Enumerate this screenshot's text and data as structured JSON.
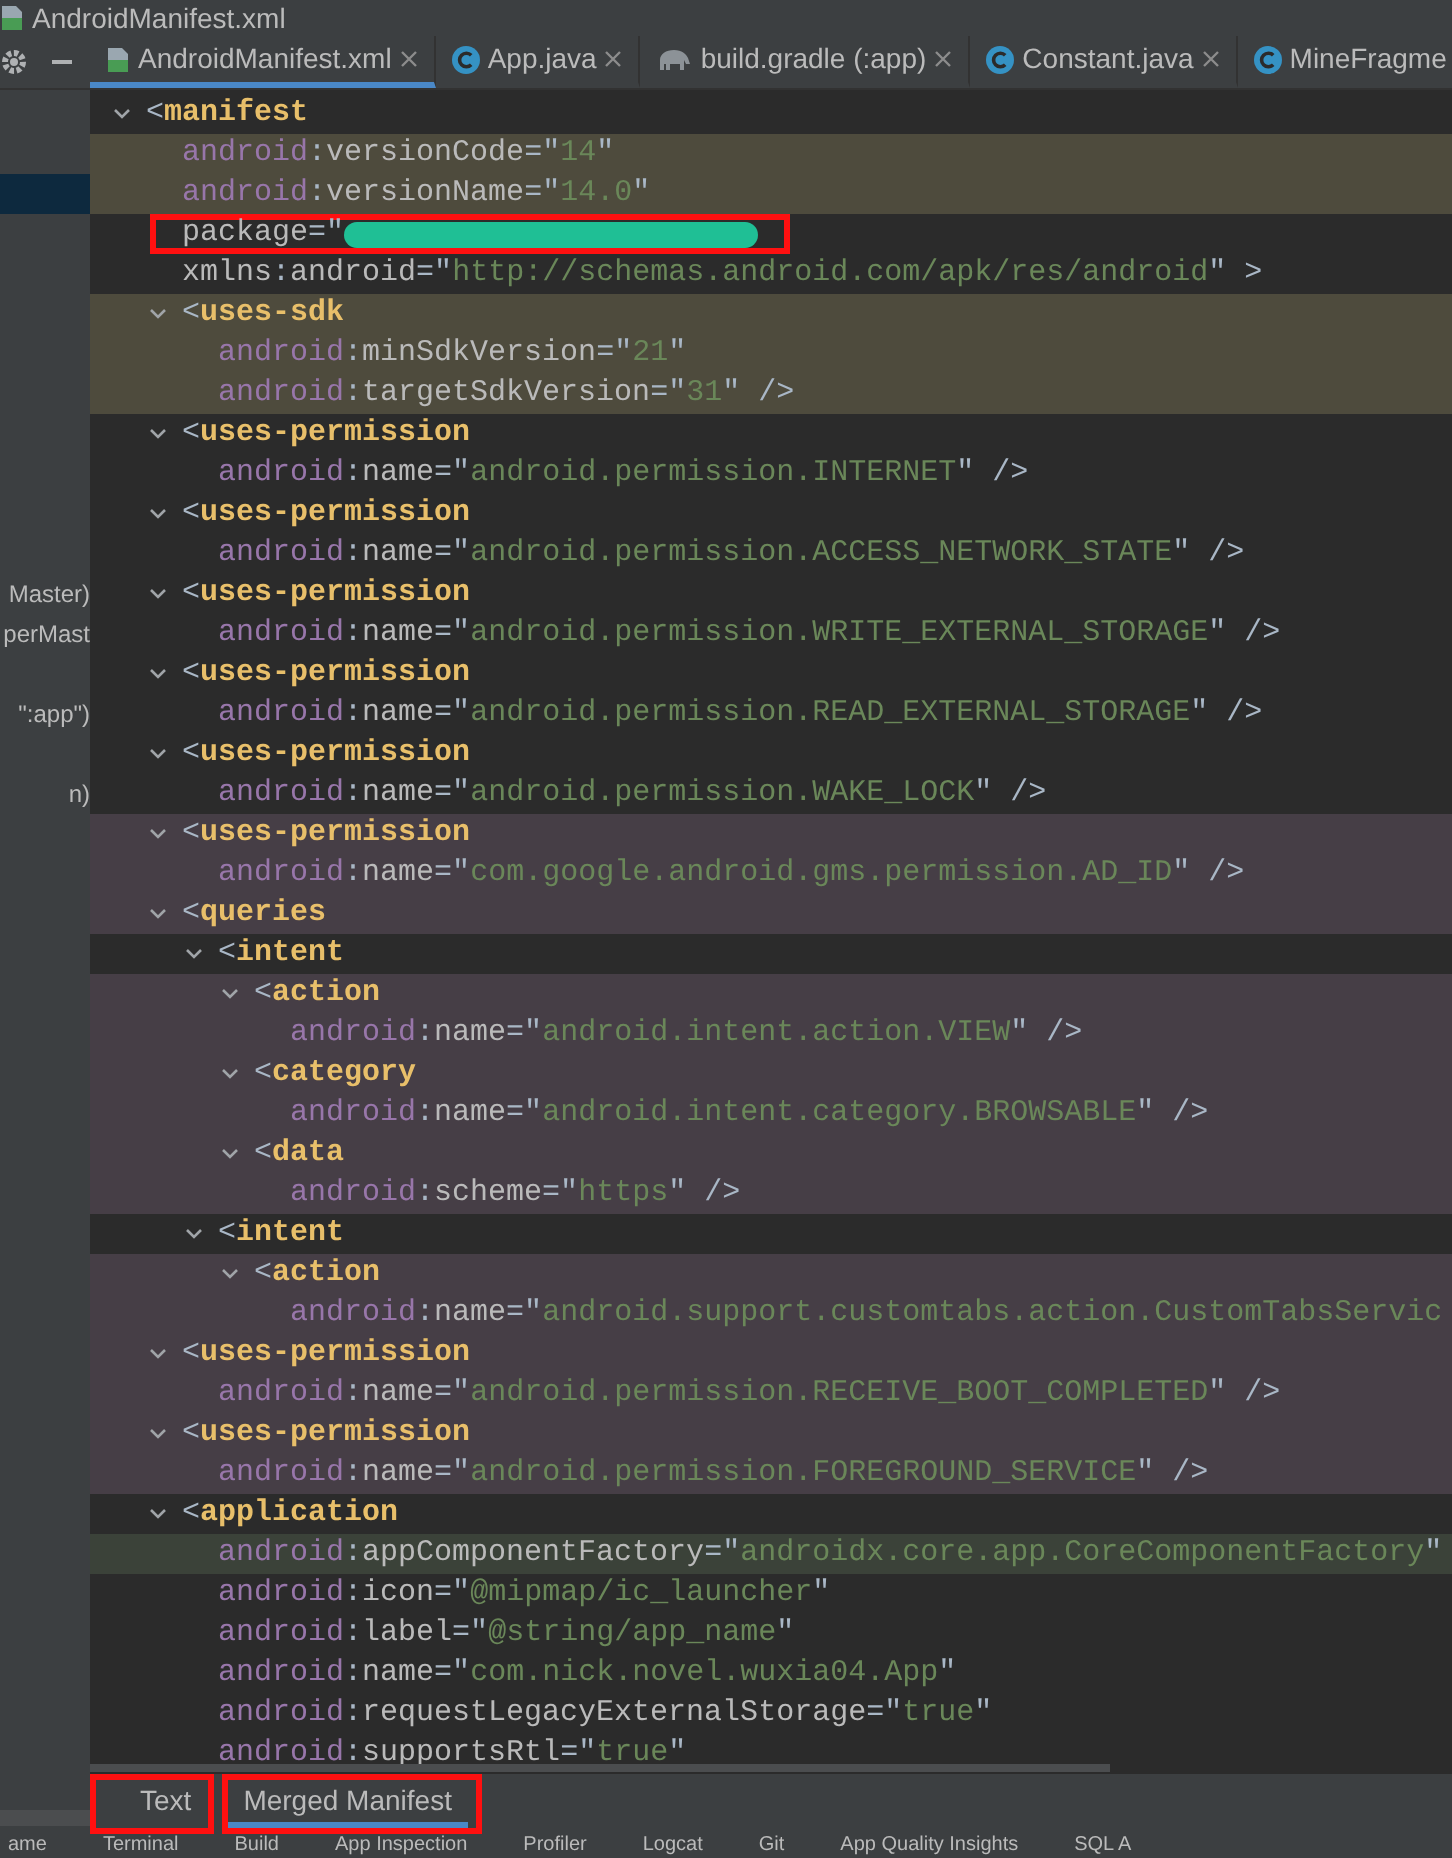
{
  "window": {
    "title": "AndroidManifest.xml"
  },
  "editor_tabs": [
    {
      "label": "AndroidManifest.xml",
      "kind": "manifest",
      "selected": true
    },
    {
      "label": "App.java",
      "kind": "class",
      "selected": false
    },
    {
      "label": "build.gradle (:app)",
      "kind": "gradle",
      "selected": false
    },
    {
      "label": "Constant.java",
      "kind": "class",
      "selected": false
    },
    {
      "label": "MineFragme",
      "kind": "class",
      "selected": false
    }
  ],
  "sidebar": {
    "rows": [
      {
        "selected": true
      },
      {
        "selected": false,
        "text": "Master)"
      },
      {
        "selected": false,
        "text": "perMast"
      },
      {
        "selected": false,
        "text": "\":app\")"
      },
      {
        "selected": false,
        "text": "n)"
      }
    ]
  },
  "manifest": {
    "expanded": true,
    "segments": [
      {
        "kind": "punct",
        "text": "<"
      },
      {
        "kind": "tag",
        "text": "manifest"
      }
    ],
    "children": [
      {
        "color": "#4e4b3d",
        "segments": [
          {
            "kind": "ns",
            "text": "android"
          },
          {
            "kind": "punct",
            "text": ":"
          },
          {
            "kind": "attr",
            "text": "versionCode"
          },
          {
            "kind": "punct",
            "text": "=\""
          },
          {
            "kind": "value",
            "text": "14"
          },
          {
            "kind": "punct",
            "text": "\""
          }
        ]
      },
      {
        "color": "#4e4b3d",
        "segments": [
          {
            "kind": "ns",
            "text": "android"
          },
          {
            "kind": "punct",
            "text": ":"
          },
          {
            "kind": "attr",
            "text": "versionName"
          },
          {
            "kind": "punct",
            "text": "=\""
          },
          {
            "kind": "value",
            "text": "14.0"
          },
          {
            "kind": "punct",
            "text": "\""
          }
        ]
      },
      {
        "outlined": true,
        "segments": [
          {
            "kind": "attr",
            "text": "package"
          },
          {
            "kind": "punct",
            "text": "=\""
          },
          {
            "kind": "redacted"
          }
        ]
      },
      {
        "segments": [
          {
            "kind": "attr",
            "text": "xmlns"
          },
          {
            "kind": "punct",
            "text": ":"
          },
          {
            "kind": "attr",
            "text": "android"
          },
          {
            "kind": "punct",
            "text": "=\""
          },
          {
            "kind": "value",
            "text": "http://schemas.android.com/apk/res/android"
          },
          {
            "kind": "punct",
            "text": "\" >"
          }
        ]
      },
      {
        "color": "#4e4b3d",
        "expanded": true,
        "segments": [
          {
            "kind": "punct",
            "text": "<"
          },
          {
            "kind": "tag",
            "text": "uses-sdk"
          }
        ],
        "children": [
          {
            "color": "#4e4b3d",
            "segments": [
              {
                "kind": "ns",
                "text": "android"
              },
              {
                "kind": "punct",
                "text": ":"
              },
              {
                "kind": "attr",
                "text": "minSdkVersion"
              },
              {
                "kind": "punct",
                "text": "=\""
              },
              {
                "kind": "value",
                "text": "21"
              },
              {
                "kind": "punct",
                "text": "\""
              }
            ]
          },
          {
            "color": "#4e4b3d",
            "segments": [
              {
                "kind": "ns",
                "text": "android"
              },
              {
                "kind": "punct",
                "text": ":"
              },
              {
                "kind": "attr",
                "text": "targetSdkVersion"
              },
              {
                "kind": "punct",
                "text": "=\""
              },
              {
                "kind": "value",
                "text": "31"
              },
              {
                "kind": "punct",
                "text": "\" />"
              }
            ]
          }
        ]
      },
      {
        "expanded": true,
        "segments": [
          {
            "kind": "punct",
            "text": "<"
          },
          {
            "kind": "tag",
            "text": "uses-permission"
          }
        ],
        "children": [
          {
            "segments": [
              {
                "kind": "ns",
                "text": "android"
              },
              {
                "kind": "punct",
                "text": ":"
              },
              {
                "kind": "attr",
                "text": "name"
              },
              {
                "kind": "punct",
                "text": "=\""
              },
              {
                "kind": "value",
                "text": "android.permission.INTERNET"
              },
              {
                "kind": "punct",
                "text": "\" />"
              }
            ]
          }
        ]
      },
      {
        "expanded": true,
        "segments": [
          {
            "kind": "punct",
            "text": "<"
          },
          {
            "kind": "tag",
            "text": "uses-permission"
          }
        ],
        "children": [
          {
            "segments": [
              {
                "kind": "ns",
                "text": "android"
              },
              {
                "kind": "punct",
                "text": ":"
              },
              {
                "kind": "attr",
                "text": "name"
              },
              {
                "kind": "punct",
                "text": "=\""
              },
              {
                "kind": "value",
                "text": "android.permission.ACCESS_NETWORK_STATE"
              },
              {
                "kind": "punct",
                "text": "\" />"
              }
            ]
          }
        ]
      },
      {
        "expanded": true,
        "segments": [
          {
            "kind": "punct",
            "text": "<"
          },
          {
            "kind": "tag",
            "text": "uses-permission"
          }
        ],
        "children": [
          {
            "segments": [
              {
                "kind": "ns",
                "text": "android"
              },
              {
                "kind": "punct",
                "text": ":"
              },
              {
                "kind": "attr",
                "text": "name"
              },
              {
                "kind": "punct",
                "text": "=\""
              },
              {
                "kind": "value",
                "text": "android.permission.WRITE_EXTERNAL_STORAGE"
              },
              {
                "kind": "punct",
                "text": "\" />"
              }
            ]
          }
        ]
      },
      {
        "expanded": true,
        "segments": [
          {
            "kind": "punct",
            "text": "<"
          },
          {
            "kind": "tag",
            "text": "uses-permission"
          }
        ],
        "children": [
          {
            "segments": [
              {
                "kind": "ns",
                "text": "android"
              },
              {
                "kind": "punct",
                "text": ":"
              },
              {
                "kind": "attr",
                "text": "name"
              },
              {
                "kind": "punct",
                "text": "=\""
              },
              {
                "kind": "value",
                "text": "android.permission.READ_EXTERNAL_STORAGE"
              },
              {
                "kind": "punct",
                "text": "\" />"
              }
            ]
          }
        ]
      },
      {
        "expanded": true,
        "segments": [
          {
            "kind": "punct",
            "text": "<"
          },
          {
            "kind": "tag",
            "text": "uses-permission"
          }
        ],
        "children": [
          {
            "segments": [
              {
                "kind": "ns",
                "text": "android"
              },
              {
                "kind": "punct",
                "text": ":"
              },
              {
                "kind": "attr",
                "text": "name"
              },
              {
                "kind": "punct",
                "text": "=\""
              },
              {
                "kind": "value",
                "text": "android.permission.WAKE_LOCK"
              },
              {
                "kind": "punct",
                "text": "\" />"
              }
            ]
          }
        ]
      },
      {
        "color": "#463e46",
        "expanded": true,
        "segments": [
          {
            "kind": "punct",
            "text": "<"
          },
          {
            "kind": "tag",
            "text": "uses-permission"
          }
        ],
        "children": [
          {
            "color": "#463e46",
            "segments": [
              {
                "kind": "ns",
                "text": "android"
              },
              {
                "kind": "punct",
                "text": ":"
              },
              {
                "kind": "attr",
                "text": "name"
              },
              {
                "kind": "punct",
                "text": "=\""
              },
              {
                "kind": "value",
                "text": "com.google.android.gms.permission.AD_ID"
              },
              {
                "kind": "punct",
                "text": "\" />"
              }
            ]
          }
        ]
      },
      {
        "color": "#463e46",
        "expanded": true,
        "segments": [
          {
            "kind": "punct",
            "text": "<"
          },
          {
            "kind": "tag",
            "text": "queries"
          }
        ],
        "children": [
          {
            "expanded": true,
            "segments": [
              {
                "kind": "punct",
                "text": "<"
              },
              {
                "kind": "tag",
                "text": "intent"
              }
            ],
            "children": [
              {
                "color": "#463e46",
                "expanded": true,
                "segments": [
                  {
                    "kind": "punct",
                    "text": "<"
                  },
                  {
                    "kind": "tag",
                    "text": "action"
                  }
                ],
                "children": [
                  {
                    "color": "#463e46",
                    "segments": [
                      {
                        "kind": "ns",
                        "text": "android"
                      },
                      {
                        "kind": "punct",
                        "text": ":"
                      },
                      {
                        "kind": "attr",
                        "text": "name"
                      },
                      {
                        "kind": "punct",
                        "text": "=\""
                      },
                      {
                        "kind": "value",
                        "text": "android.intent.action.VIEW"
                      },
                      {
                        "kind": "punct",
                        "text": "\" />"
                      }
                    ]
                  }
                ]
              },
              {
                "color": "#463e46",
                "expanded": true,
                "segments": [
                  {
                    "kind": "punct",
                    "text": "<"
                  },
                  {
                    "kind": "tag",
                    "text": "category"
                  }
                ],
                "children": [
                  {
                    "color": "#463e46",
                    "segments": [
                      {
                        "kind": "ns",
                        "text": "android"
                      },
                      {
                        "kind": "punct",
                        "text": ":"
                      },
                      {
                        "kind": "attr",
                        "text": "name"
                      },
                      {
                        "kind": "punct",
                        "text": "=\""
                      },
                      {
                        "kind": "value",
                        "text": "android.intent.category.BROWSABLE"
                      },
                      {
                        "kind": "punct",
                        "text": "\" />"
                      }
                    ]
                  }
                ]
              },
              {
                "color": "#463e46",
                "expanded": true,
                "segments": [
                  {
                    "kind": "punct",
                    "text": "<"
                  },
                  {
                    "kind": "tag",
                    "text": "data"
                  }
                ],
                "children": [
                  {
                    "color": "#463e46",
                    "segments": [
                      {
                        "kind": "ns",
                        "text": "android"
                      },
                      {
                        "kind": "punct",
                        "text": ":"
                      },
                      {
                        "kind": "attr",
                        "text": "scheme"
                      },
                      {
                        "kind": "punct",
                        "text": "=\""
                      },
                      {
                        "kind": "value",
                        "text": "https"
                      },
                      {
                        "kind": "punct",
                        "text": "\" />"
                      }
                    ]
                  }
                ]
              }
            ]
          },
          {
            "expanded": true,
            "segments": [
              {
                "kind": "punct",
                "text": "<"
              },
              {
                "kind": "tag",
                "text": "intent"
              }
            ],
            "children": [
              {
                "color": "#463e46",
                "expanded": true,
                "segments": [
                  {
                    "kind": "punct",
                    "text": "<"
                  },
                  {
                    "kind": "tag",
                    "text": "action"
                  }
                ],
                "children": [
                  {
                    "color": "#463e46",
                    "segments": [
                      {
                        "kind": "ns",
                        "text": "android"
                      },
                      {
                        "kind": "punct",
                        "text": ":"
                      },
                      {
                        "kind": "attr",
                        "text": "name"
                      },
                      {
                        "kind": "punct",
                        "text": "=\""
                      },
                      {
                        "kind": "value",
                        "text": "android.support.customtabs.action.CustomTabsServic"
                      }
                    ]
                  }
                ]
              }
            ]
          }
        ]
      },
      {
        "color": "#463e46",
        "expanded": true,
        "segments": [
          {
            "kind": "punct",
            "text": "<"
          },
          {
            "kind": "tag",
            "text": "uses-permission"
          }
        ],
        "children": [
          {
            "color": "#463e46",
            "segments": [
              {
                "kind": "ns",
                "text": "android"
              },
              {
                "kind": "punct",
                "text": ":"
              },
              {
                "kind": "attr",
                "text": "name"
              },
              {
                "kind": "punct",
                "text": "=\""
              },
              {
                "kind": "value",
                "text": "android.permission.RECEIVE_BOOT_COMPLETED"
              },
              {
                "kind": "punct",
                "text": "\" />"
              }
            ]
          }
        ]
      },
      {
        "color": "#463e46",
        "expanded": true,
        "segments": [
          {
            "kind": "punct",
            "text": "<"
          },
          {
            "kind": "tag",
            "text": "uses-permission"
          }
        ],
        "children": [
          {
            "color": "#463e46",
            "segments": [
              {
                "kind": "ns",
                "text": "android"
              },
              {
                "kind": "punct",
                "text": ":"
              },
              {
                "kind": "attr",
                "text": "name"
              },
              {
                "kind": "punct",
                "text": "=\""
              },
              {
                "kind": "value",
                "text": "android.permission.FOREGROUND_SERVICE"
              },
              {
                "kind": "punct",
                "text": "\" />"
              }
            ]
          }
        ]
      },
      {
        "expanded": true,
        "segments": [
          {
            "kind": "punct",
            "text": "<"
          },
          {
            "kind": "tag",
            "text": "application"
          }
        ],
        "children": [
          {
            "color": "#3b4239",
            "segments": [
              {
                "kind": "ns",
                "text": "android"
              },
              {
                "kind": "punct",
                "text": ":"
              },
              {
                "kind": "attr",
                "text": "appComponentFactory"
              },
              {
                "kind": "punct",
                "text": "=\""
              },
              {
                "kind": "value",
                "text": "androidx.core.app.CoreComponentFactory"
              },
              {
                "kind": "punct",
                "text": "\""
              }
            ]
          },
          {
            "segments": [
              {
                "kind": "ns",
                "text": "android"
              },
              {
                "kind": "punct",
                "text": ":"
              },
              {
                "kind": "attr",
                "text": "icon"
              },
              {
                "kind": "punct",
                "text": "=\""
              },
              {
                "kind": "value",
                "text": "@mipmap/ic_launcher"
              },
              {
                "kind": "punct",
                "text": "\""
              }
            ]
          },
          {
            "segments": [
              {
                "kind": "ns",
                "text": "android"
              },
              {
                "kind": "punct",
                "text": ":"
              },
              {
                "kind": "attr",
                "text": "label"
              },
              {
                "kind": "punct",
                "text": "=\""
              },
              {
                "kind": "value",
                "text": "@string/app_name"
              },
              {
                "kind": "punct",
                "text": "\""
              }
            ]
          },
          {
            "segments": [
              {
                "kind": "ns",
                "text": "android"
              },
              {
                "kind": "punct",
                "text": ":"
              },
              {
                "kind": "attr",
                "text": "name"
              },
              {
                "kind": "punct",
                "text": "=\""
              },
              {
                "kind": "value",
                "text": "com.nick.novel.wuxia04.App"
              },
              {
                "kind": "punct",
                "text": "\""
              }
            ]
          },
          {
            "segments": [
              {
                "kind": "ns",
                "text": "android"
              },
              {
                "kind": "punct",
                "text": ":"
              },
              {
                "kind": "attr",
                "text": "requestLegacyExternalStorage"
              },
              {
                "kind": "punct",
                "text": "=\""
              },
              {
                "kind": "value",
                "text": "true"
              },
              {
                "kind": "punct",
                "text": "\""
              }
            ]
          },
          {
            "segments": [
              {
                "kind": "ns",
                "text": "android"
              },
              {
                "kind": "punct",
                "text": ":"
              },
              {
                "kind": "attr",
                "text": "supportsRtl"
              },
              {
                "kind": "punct",
                "text": "=\""
              },
              {
                "kind": "value",
                "text": "true"
              },
              {
                "kind": "punct",
                "text": "\""
              }
            ]
          }
        ]
      }
    ]
  },
  "view_tabs": [
    {
      "label": "Text",
      "selected": false,
      "outlined": true
    },
    {
      "label": "Merged Manifest",
      "selected": true,
      "outlined": true
    }
  ],
  "tool_windows": [
    {
      "label": "ame"
    },
    {
      "label": "Terminal"
    },
    {
      "label": "Build"
    },
    {
      "label": "App Inspection"
    },
    {
      "label": "Profiler"
    },
    {
      "label": "Logcat"
    },
    {
      "label": "Git"
    },
    {
      "label": "App Quality Insights"
    },
    {
      "label": "SQL A"
    }
  ]
}
